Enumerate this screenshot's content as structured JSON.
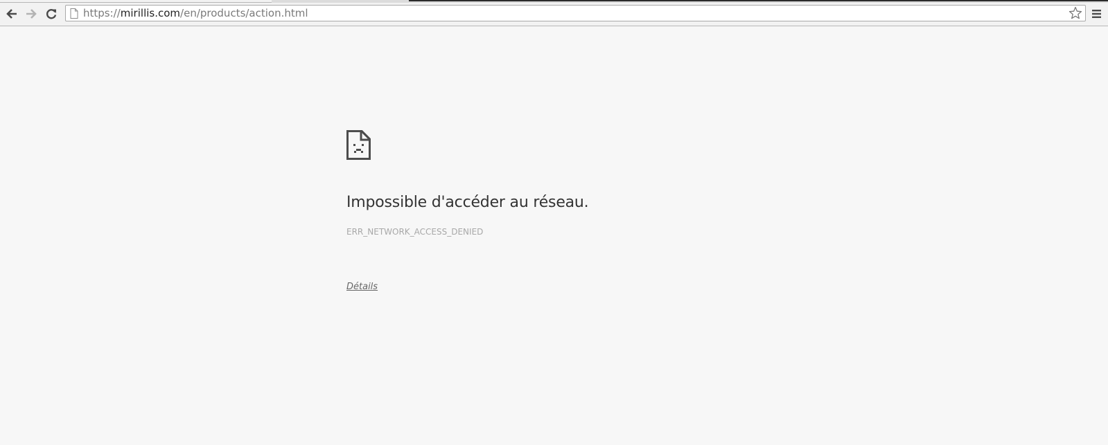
{
  "browser": {
    "url_prefix": "https://",
    "url_host": "mirillis.com",
    "url_path": "/en/products/action.html"
  },
  "icons": {
    "back": "back-arrow-icon",
    "forward": "forward-arrow-icon",
    "reload": "reload-icon",
    "page": "page-icon",
    "bookmark": "star-icon",
    "menu": "hamburger-menu-icon",
    "error": "sad-page-icon"
  },
  "error_page": {
    "heading": "Impossible d'accéder au réseau.",
    "code": "ERR_NETWORK_ACCESS_DENIED",
    "details_link": "Détails"
  },
  "colors": {
    "page_background": "#f7f7f7",
    "heading": "#333333",
    "error_code": "#a8a8a8",
    "link": "#666666"
  }
}
